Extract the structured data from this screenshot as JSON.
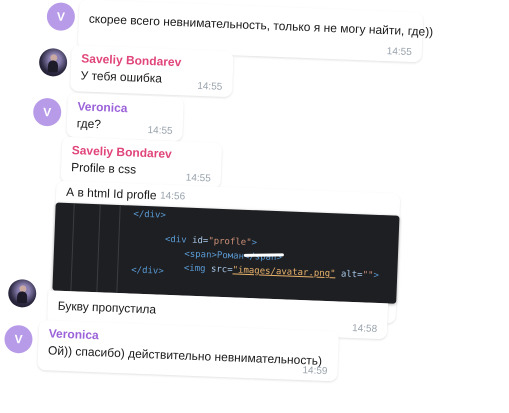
{
  "messages": [
    {
      "text": "скорее всего невнимательность, только я не могу найти, где))",
      "time": "14:55"
    },
    {
      "sender": "Saveliy Bondarev",
      "text": "У тебя ошибка",
      "time": "14:55"
    },
    {
      "sender": "Veronica",
      "text": "где?",
      "time": "14:55"
    },
    {
      "sender": "Saveliy Bondarev",
      "text": "Profile в css",
      "time": "14:55"
    },
    {
      "text": "А в html Id profle",
      "time": "14:56"
    },
    {
      "text": "Букву пропустила",
      "time": "14:58"
    },
    {
      "sender": "Veronica",
      "text": "Ой)) спасибо) действительно невнимательность)",
      "time": "14:59"
    }
  ],
  "avatars": {
    "veronica": "V"
  },
  "code": {
    "line1": "</div>",
    "line2_tag": "<div",
    "line2_attr": "id=",
    "line2_str": "\"profle\"",
    "line2_end": ">",
    "line3": "<span>Роман</span>",
    "line4_tag": "<img",
    "line4_attr": "src=",
    "line4_str": "\"images/avatar.png\"",
    "line4_attr2": "alt=",
    "line4_str2": "\"\"",
    "line4_end": ">",
    "line5": "</div>"
  },
  "colors": {
    "saveliy": "#e0457b",
    "veronica": "#9b62d9",
    "avatar_v": "#b89be8"
  }
}
